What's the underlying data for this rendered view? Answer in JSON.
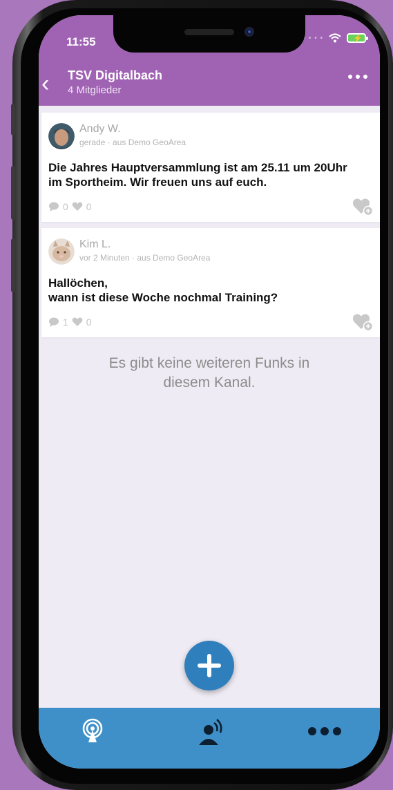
{
  "status_bar": {
    "time": "11:55"
  },
  "header": {
    "title": "TSV Digitalbach",
    "subtitle": "4 Mitglieder"
  },
  "posts": [
    {
      "author": "Andy W.",
      "meta": "gerade · aus Demo GeoArea",
      "lines": [
        "Die Jahres Hauptversammlung ist am 25.11 um 20Uhr",
        "im Sportheim. Wir freuen uns auf euch."
      ],
      "comments": "0",
      "likes": "0"
    },
    {
      "author": "Kim L.",
      "meta": "vor 2 Minuten · aus Demo GeoArea",
      "lines": [
        "Hallöchen,",
        "wann ist diese Woche nochmal Training?"
      ],
      "comments": "1",
      "likes": "0"
    }
  ],
  "empty_state": {
    "line1": "Es gibt keine weiteren Funks in",
    "line2": "diesem Kanal."
  },
  "tabbar": {
    "tabs": [
      "radio-broadcast-icon",
      "person-broadcast-icon",
      "more-dots-icon"
    ]
  },
  "colors": {
    "header": "#a062b3",
    "tabbar": "#3f90c9",
    "fab": "#2f7fbd",
    "background": "#a977bb"
  }
}
